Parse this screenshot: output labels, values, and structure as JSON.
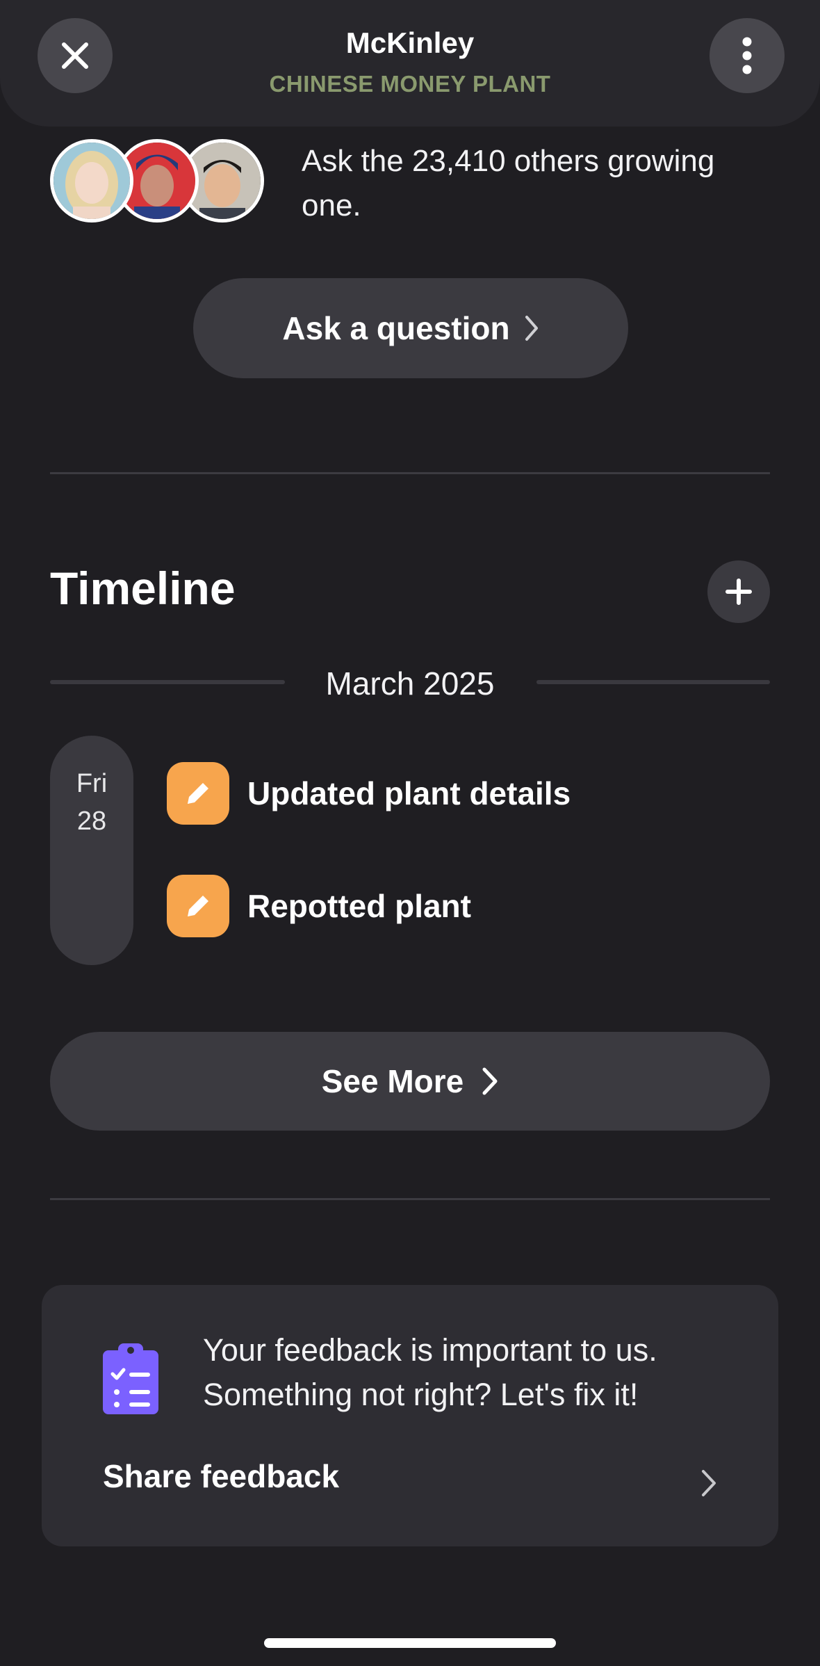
{
  "header": {
    "title": "McKinley",
    "subtitle": "CHINESE MONEY PLANT",
    "close_icon": "close-icon",
    "more_icon": "more-vertical-icon",
    "subtitle_color": "#8a9a6e"
  },
  "community": {
    "text": "Ask the 23,410 others growing one.",
    "ask_button_label": "Ask a question",
    "avatars": [
      "avatar-blonde-woman",
      "avatar-superhero",
      "avatar-man-glasses"
    ]
  },
  "timeline": {
    "title": "Timeline",
    "add_icon": "plus-icon",
    "month": "March 2025",
    "date": {
      "day_of_week": "Fri",
      "day": "28"
    },
    "events": [
      {
        "label": "Updated plant details",
        "icon": "pencil-icon"
      },
      {
        "label": "Repotted plant",
        "icon": "pencil-icon"
      }
    ],
    "event_icon_color": "#f7a54d",
    "see_more_label": "See More"
  },
  "feedback": {
    "message": "Your feedback is important to us. Something not right? Let's fix it!",
    "link_label": "Share feedback",
    "icon": "clipboard-checklist-icon",
    "icon_color": "#7b61ff"
  }
}
